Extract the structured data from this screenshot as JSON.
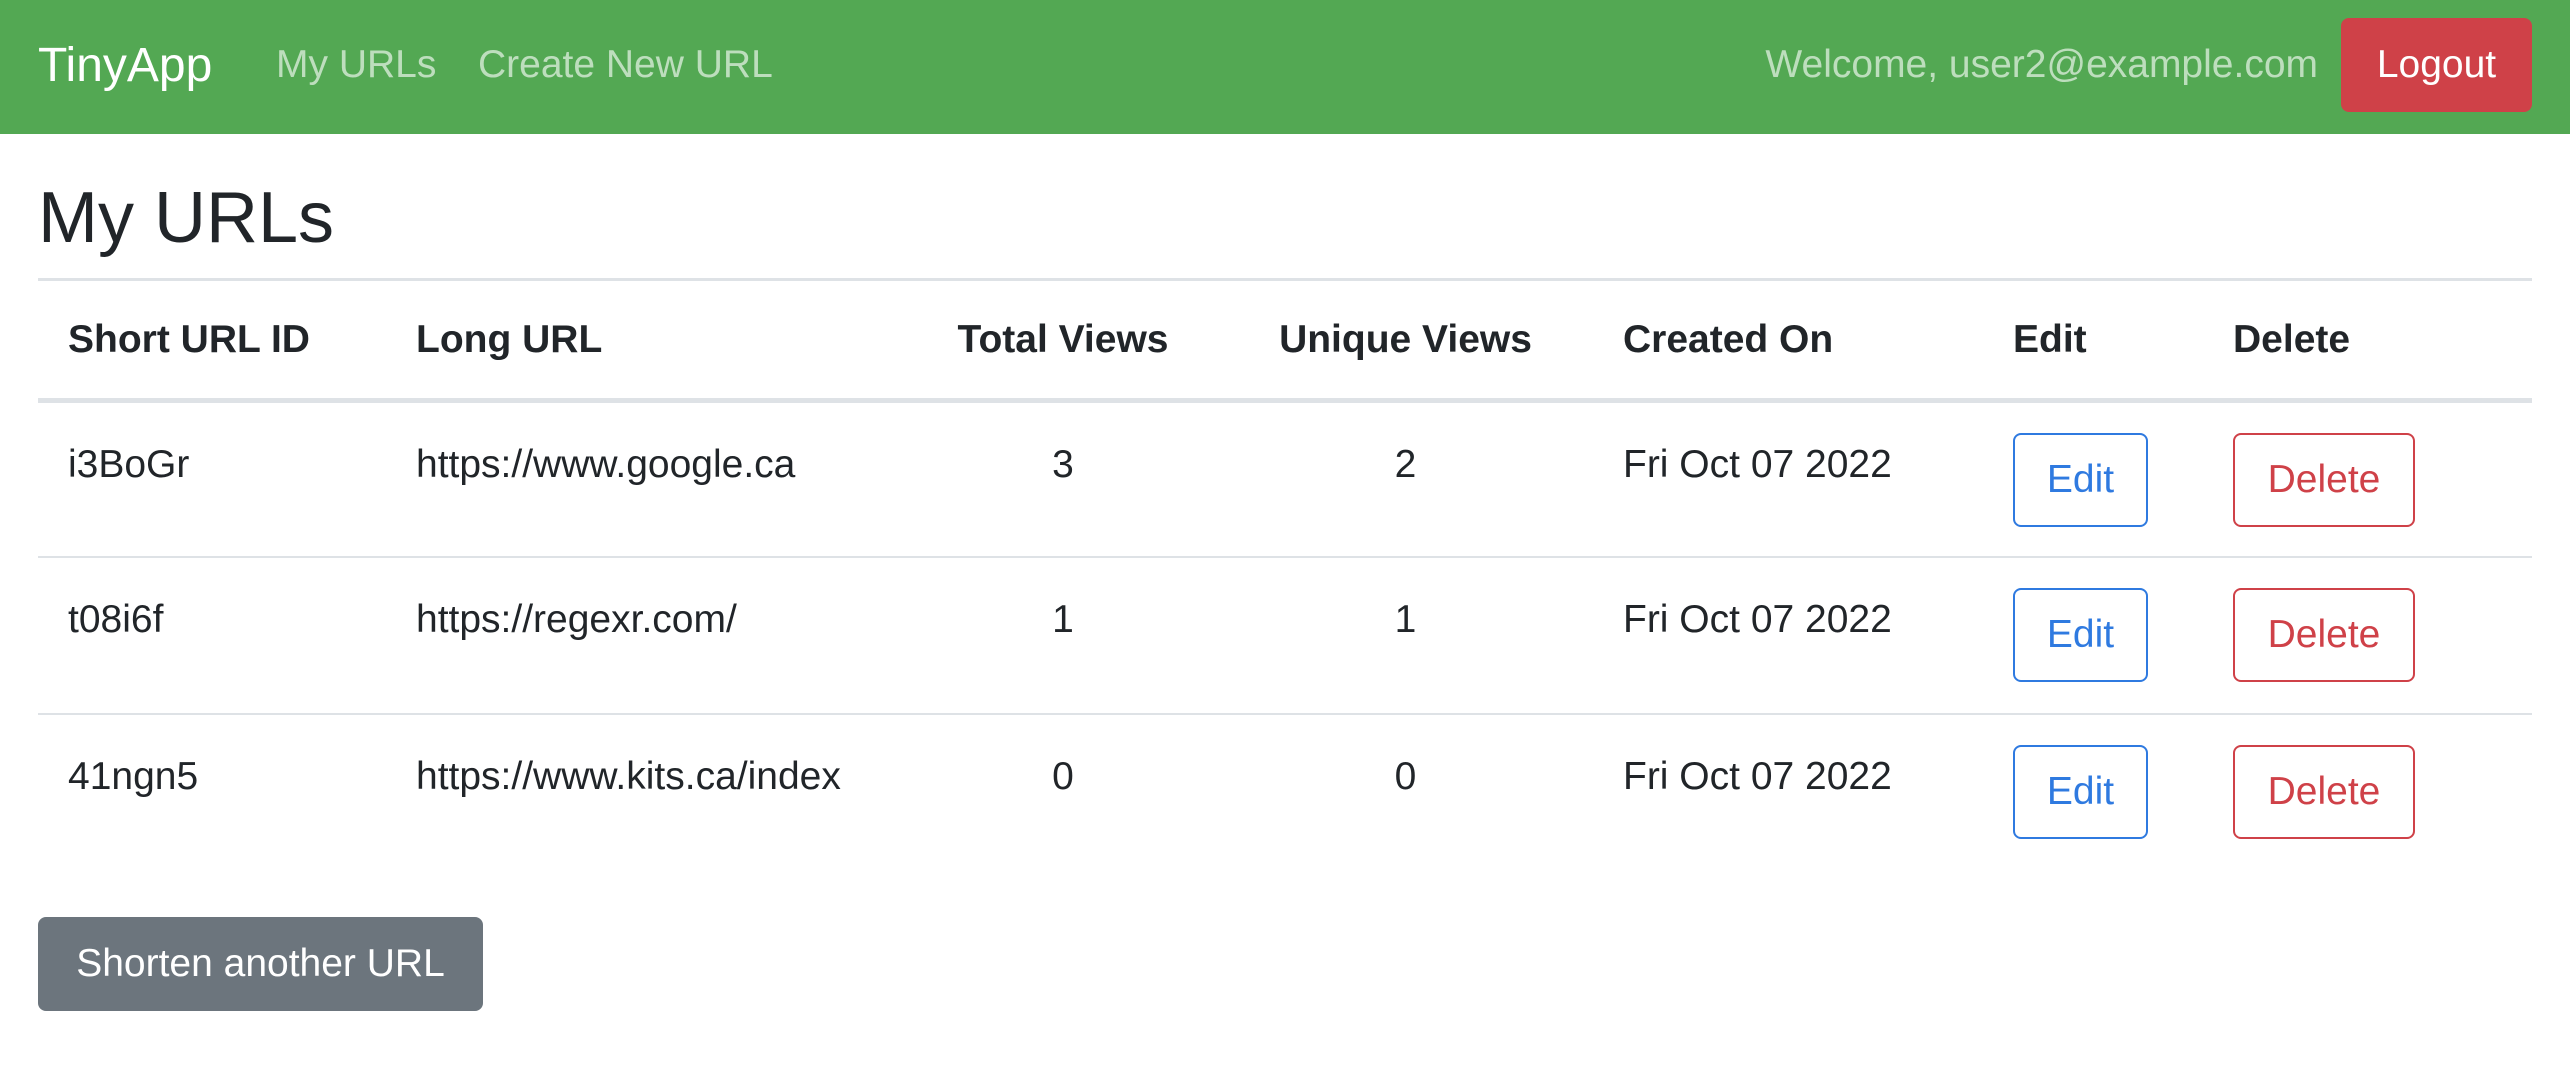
{
  "navbar": {
    "brand": "TinyApp",
    "links": [
      {
        "label": "My URLs"
      },
      {
        "label": "Create New URL"
      }
    ],
    "welcome": "Welcome, user2@example.com",
    "logout_label": "Logout",
    "background_color": "#53a853",
    "logout_color": "#cf4148"
  },
  "main": {
    "title": "My URLs",
    "table": {
      "headers": [
        "Short URL ID",
        "Long URL",
        "Total Views",
        "Unique Views",
        "Created On",
        "Edit",
        "Delete"
      ],
      "rows": [
        {
          "short_id": "i3BoGr",
          "long_url": "https://www.google.ca",
          "total_views": "3",
          "unique_views": "2",
          "created_on": "Fri Oct 07 2022",
          "edit_label": "Edit",
          "delete_label": "Delete"
        },
        {
          "short_id": "t08i6f",
          "long_url": "https://regexr.com/",
          "total_views": "1",
          "unique_views": "1",
          "created_on": "Fri Oct 07 2022",
          "edit_label": "Edit",
          "delete_label": "Delete"
        },
        {
          "short_id": "41ngn5",
          "long_url": "https://www.kits.ca/index",
          "total_views": "0",
          "unique_views": "0",
          "created_on": "Fri Oct 07 2022",
          "edit_label": "Edit",
          "delete_label": "Delete"
        }
      ]
    },
    "shorten_label": "Shorten another URL",
    "colors": {
      "edit": "#2f7ae0",
      "delete": "#cf4148",
      "secondary": "#6c757d"
    }
  }
}
